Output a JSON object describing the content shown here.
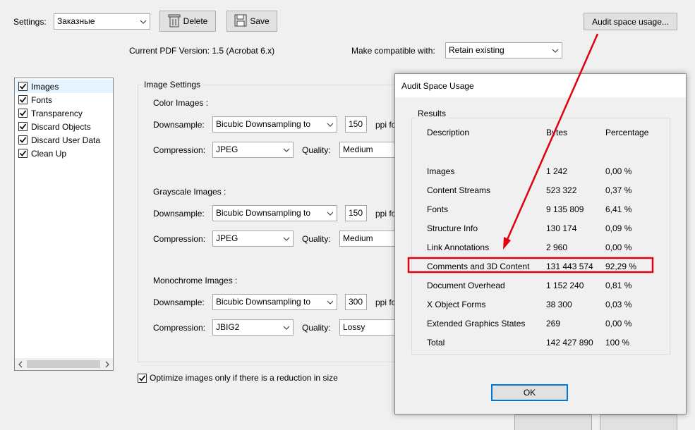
{
  "toolbar": {
    "settings_label": "Settings:",
    "settings_value": "Заказные",
    "delete_label": "Delete",
    "save_label": "Save",
    "audit_label": "Audit space usage..."
  },
  "pdf_version": "Current PDF Version: 1.5 (Acrobat 6.x)",
  "compat": {
    "label": "Make compatible with:",
    "value": "Retain existing"
  },
  "sidebar": {
    "items": [
      {
        "label": "Images",
        "checked": true,
        "selected": true
      },
      {
        "label": "Fonts",
        "checked": true
      },
      {
        "label": "Transparency",
        "checked": true
      },
      {
        "label": "Discard Objects",
        "checked": true
      },
      {
        "label": "Discard User Data",
        "checked": true
      },
      {
        "label": "Clean Up",
        "checked": true
      }
    ]
  },
  "image_settings": {
    "title": "Image Settings",
    "downsample_label": "Downsample:",
    "compression_label": "Compression:",
    "quality_label": "Quality:",
    "ppi_label": "ppi fo",
    "color": {
      "title": "Color Images :",
      "downsample": "Bicubic Downsampling to",
      "ppi": "150",
      "compression": "JPEG",
      "quality": "Medium"
    },
    "grayscale": {
      "title": "Grayscale Images :",
      "downsample": "Bicubic Downsampling to",
      "ppi": "150",
      "compression": "JPEG",
      "quality": "Medium"
    },
    "mono": {
      "title": "Monochrome Images :",
      "downsample": "Bicubic Downsampling to",
      "ppi": "300",
      "compression": "JBIG2",
      "quality": "Lossy"
    }
  },
  "optimize_label": "Optimize images only if there is a reduction in size",
  "dialog": {
    "title": "Audit Space Usage",
    "results_label": "Results",
    "headers": [
      "Description",
      "Bytes",
      "Percentage"
    ],
    "rows": [
      [
        "Images",
        "1 242",
        "0,00 %"
      ],
      [
        "Content Streams",
        "523 322",
        "0,37 %"
      ],
      [
        "Fonts",
        "9 135 809",
        "6,41 %"
      ],
      [
        "Structure Info",
        "130 174",
        "0,09 %"
      ],
      [
        "Link Annotations",
        "2 960",
        "0,00 %"
      ],
      [
        "Comments and 3D Content",
        "131 443 574",
        "92,29 %"
      ],
      [
        "Document Overhead",
        "1 152 240",
        "0,81 %"
      ],
      [
        "X Object Forms",
        "38 300",
        "0,03 %"
      ],
      [
        "Extended Graphics States",
        "269",
        "0,00 %"
      ],
      [
        "Total",
        "142 427 890",
        "100 %"
      ]
    ],
    "ok_label": "OK"
  },
  "colors": {
    "highlight": "#e0000f",
    "ok_border": "#0078d7"
  }
}
